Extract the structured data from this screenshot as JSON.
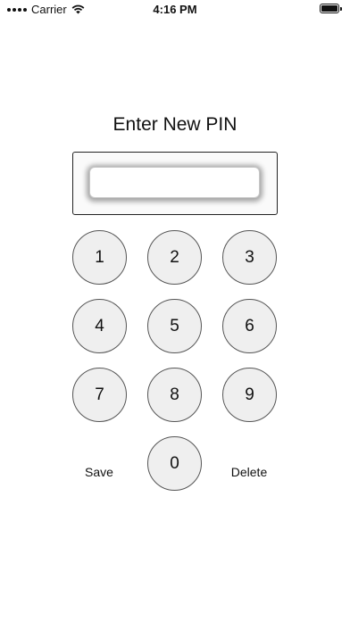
{
  "status_bar": {
    "carrier": "Carrier",
    "time": "4:16 PM"
  },
  "title": "Enter New PIN",
  "pin": {
    "value": ""
  },
  "keypad": {
    "keys": [
      "1",
      "2",
      "3",
      "4",
      "5",
      "6",
      "7",
      "8",
      "9",
      "0"
    ],
    "save_label": "Save",
    "delete_label": "Delete"
  }
}
